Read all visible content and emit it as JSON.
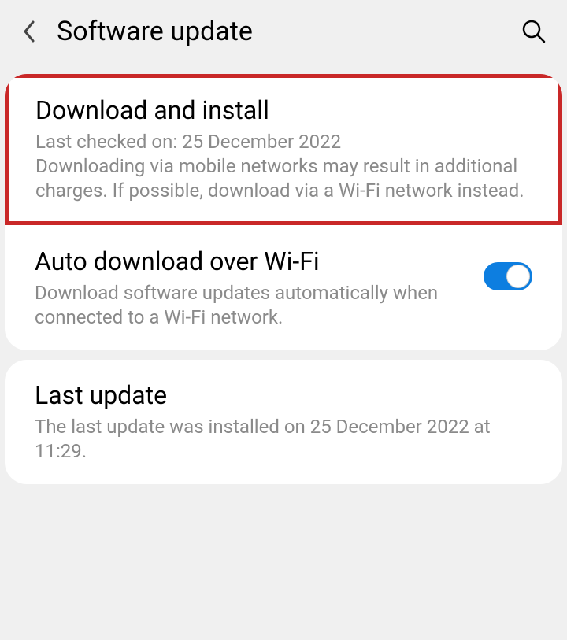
{
  "header": {
    "title": "Software update"
  },
  "items": {
    "download_install": {
      "title": "Download and install",
      "last_checked": "Last checked on: 25 December 2022",
      "warning": "Downloading via mobile networks may result in additional charges. If possible, download via a Wi-Fi network instead."
    },
    "auto_download": {
      "title": "Auto download over Wi-Fi",
      "desc": "Download software updates automatically when connected to a Wi-Fi network.",
      "enabled": true
    },
    "last_update": {
      "title": "Last update",
      "desc": "The last update was installed on 25 December 2022 at 11:29."
    }
  }
}
